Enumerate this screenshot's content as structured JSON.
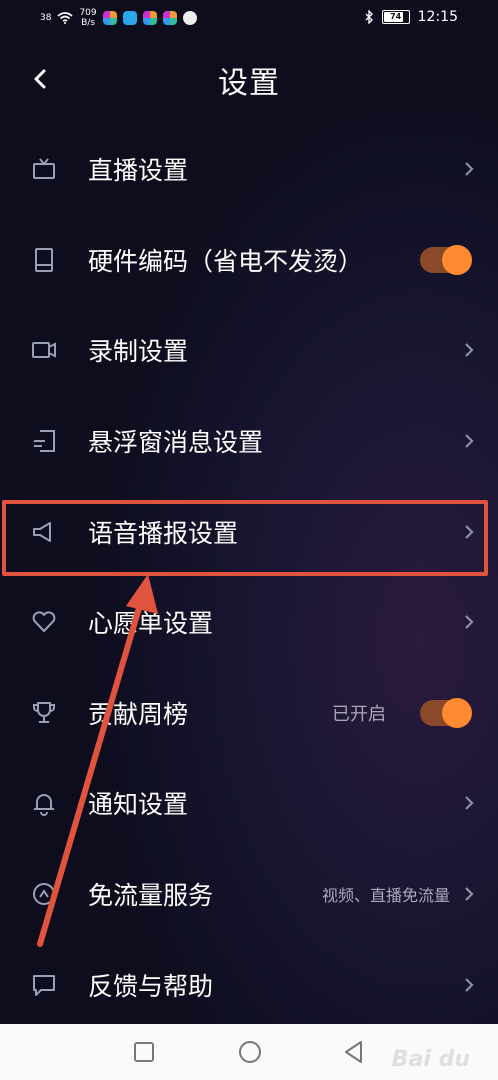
{
  "status_bar": {
    "signal": "38",
    "speed_value": "709",
    "speed_unit": "B/s",
    "battery": "74",
    "time": "12:15"
  },
  "header": {
    "title": "设置",
    "back_icon": "chevron-left-icon"
  },
  "settings": [
    {
      "label": "直播设置",
      "icon": "tv-icon",
      "control": "chevron"
    },
    {
      "label": "硬件编码（省电不发烫）",
      "icon": "tablet-icon",
      "control": "toggle",
      "toggle_on": true
    },
    {
      "label": "录制设置",
      "icon": "video-camera-icon",
      "control": "chevron"
    },
    {
      "label": "悬浮窗消息设置",
      "icon": "floating-window-icon",
      "control": "chevron"
    },
    {
      "label": "语音播报设置",
      "icon": "speaker-icon",
      "control": "chevron",
      "highlighted": true
    },
    {
      "label": "心愿单设置",
      "icon": "heart-icon",
      "control": "chevron"
    },
    {
      "label": "贡献周榜",
      "icon": "trophy-icon",
      "control": "toggle",
      "value": "已开启",
      "toggle_on": true
    },
    {
      "label": "通知设置",
      "icon": "bell-icon",
      "control": "chevron"
    },
    {
      "label": "免流量服务",
      "icon": "data-saver-icon",
      "control": "chevron",
      "value": "视频、直播免流量"
    },
    {
      "label": "反馈与帮助",
      "icon": "chat-bubble-icon",
      "control": "chevron"
    }
  ],
  "colors": {
    "accent_orange": "#ff8a30",
    "highlight_red": "#e0533e",
    "background": "#11101f"
  },
  "nav_bar": {
    "buttons": [
      "recent-apps-icon",
      "home-icon",
      "back-triangle-icon"
    ]
  },
  "watermark": "Bai du"
}
